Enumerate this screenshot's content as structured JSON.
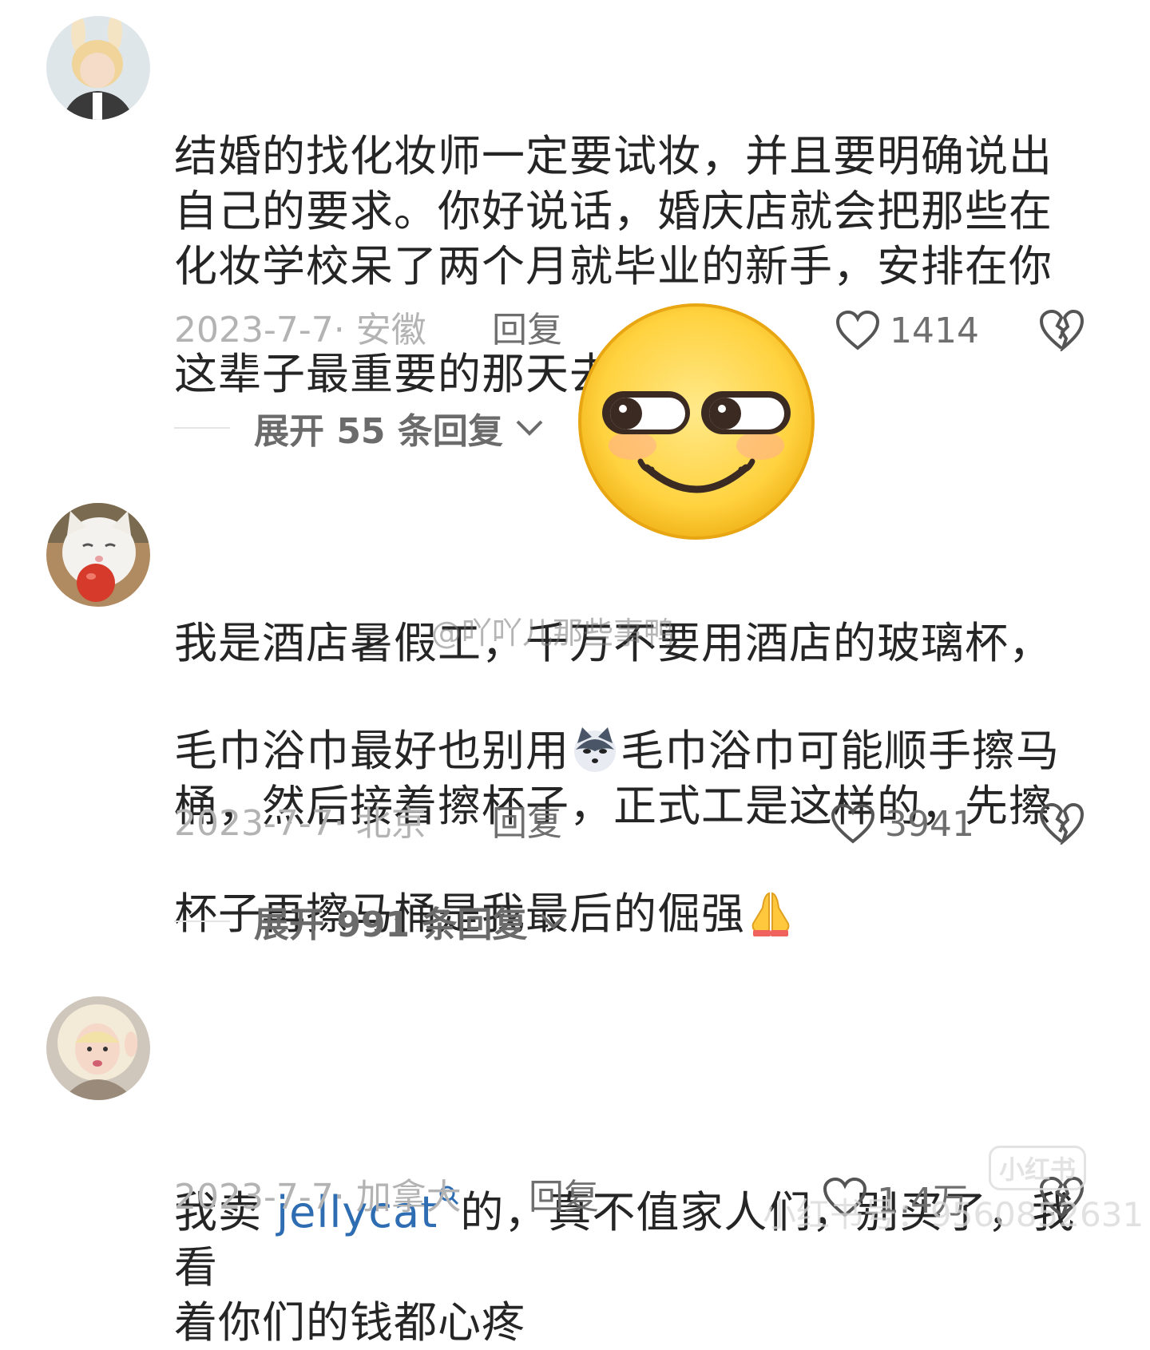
{
  "comments": [
    {
      "body": "结婚的找化妆师一定要试妆，并且要明确说出\n自己的要求。你好说话，婚庆店就会把那些在\n化妆学校呆了两个月就毕业的新手，安排在你\n这辈子最重要的那天去练手",
      "date": "2023-7-7· 安徽",
      "reply": "回复",
      "likes": "1414",
      "expand": "展开 55 条回复",
      "emoji": "husky-emoji"
    },
    {
      "body_part1": "我是酒店暑假工，千万不要用酒店的玻璃杯，\n毛巾浴巾最好也别用",
      "body_part2": "毛巾浴巾可能顺手擦马\n桶，然后接着擦杯子，正式工是这样的，先擦\n杯子再擦马桶是我最后的倔强",
      "date": "2023-7-7· 北京",
      "reply": "回复",
      "likes": "3941",
      "expand": "展开 991 条回复",
      "emoji": "husky-emoji",
      "emoji2": "praying-hands-emoji"
    },
    {
      "body_prefix": "我卖 ",
      "link": "jellycat",
      "body_suffix": "的，真不值家人们，别买了，我看\n着你们的钱都心疼",
      "date": "2023-7-7· 加拿大",
      "reply": "回复",
      "likes": "1.4万"
    }
  ],
  "watermark": "@吖吖儿那些事鸭",
  "watermark_logo": "小红书",
  "watermark_id": "小红书号：9560852631",
  "colors": {
    "link": "#2f6db3",
    "meta": "#b3b3b3",
    "text": "#252525"
  }
}
